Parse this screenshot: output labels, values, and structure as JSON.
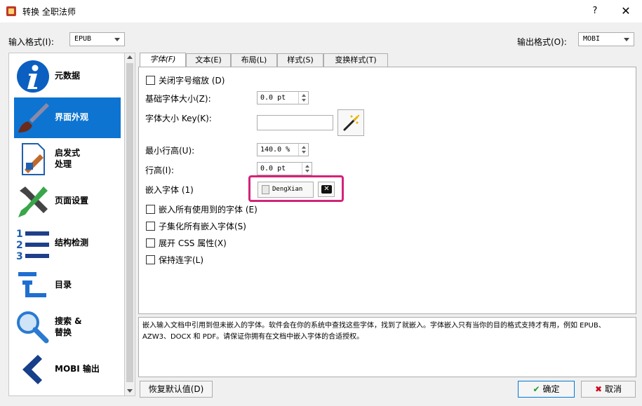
{
  "window": {
    "title": "转换 全职法师",
    "help": "?",
    "close": "✕"
  },
  "formats": {
    "input_label": "输入格式(I):",
    "input_value": "EPUB",
    "output_label": "输出格式(O):",
    "output_value": "MOBI"
  },
  "sidebar": {
    "items": [
      {
        "label": "元数据",
        "icon": "info-icon"
      },
      {
        "label": "界面外观",
        "icon": "brush-icon",
        "selected": true
      },
      {
        "label": "启发式\n处理",
        "icon": "heuristic-icon"
      },
      {
        "label": "页面设置",
        "icon": "tools-icon"
      },
      {
        "label": "结构检测",
        "icon": "list-numbered-icon"
      },
      {
        "label": "目录",
        "icon": "toc-icon"
      },
      {
        "label": "搜索 &\n替换",
        "icon": "search-icon"
      },
      {
        "label": "MOBI 输出",
        "icon": "back-arrow-icon"
      }
    ]
  },
  "tabs": [
    {
      "label": "字体(F)",
      "active": true
    },
    {
      "label": "文本(E)"
    },
    {
      "label": "布局(L)"
    },
    {
      "label": "样式(S)"
    },
    {
      "label": "变换样式(T)"
    }
  ],
  "font_panel": {
    "disable_scaling": "关闭字号缩放 (D)",
    "base_font_label": "基础字体大小(Z):",
    "base_font_value": "0.0 pt",
    "font_key_label": "字体大小 Key(K):",
    "font_key_value": "",
    "min_line_label": "最小行高(U):",
    "min_line_value": "140.0 %",
    "line_height_label": "行高(I):",
    "line_height_value": "0.0 pt",
    "embed_font_label": "嵌入字体 (1)",
    "embed_font_value": "DengXian",
    "embed_all": "嵌入所有使用到的字体 (E)",
    "subset": "子集化所有嵌入字体(S)",
    "expand_css": "展开 CSS 属性(X)",
    "keep_ligatures": "保持连字(L)"
  },
  "description": "嵌入输入文档中引用到但未嵌入的字体。软件会在你的系统中查找这些字体，找到了就嵌入。字体嵌入只有当你的目的格式支持才有用，例如 EPUB、AZW3、DOCX 和 PDF。请保证你拥有在文档中嵌入字体的合适授权。",
  "buttons": {
    "restore": "恢复默认值(D)",
    "ok": "确定",
    "cancel": "取消"
  },
  "colors": {
    "selected": "#0d74d1",
    "highlight": "#d4237a",
    "ok_check": "#1a9c2a",
    "cancel_x": "#d0021b"
  }
}
